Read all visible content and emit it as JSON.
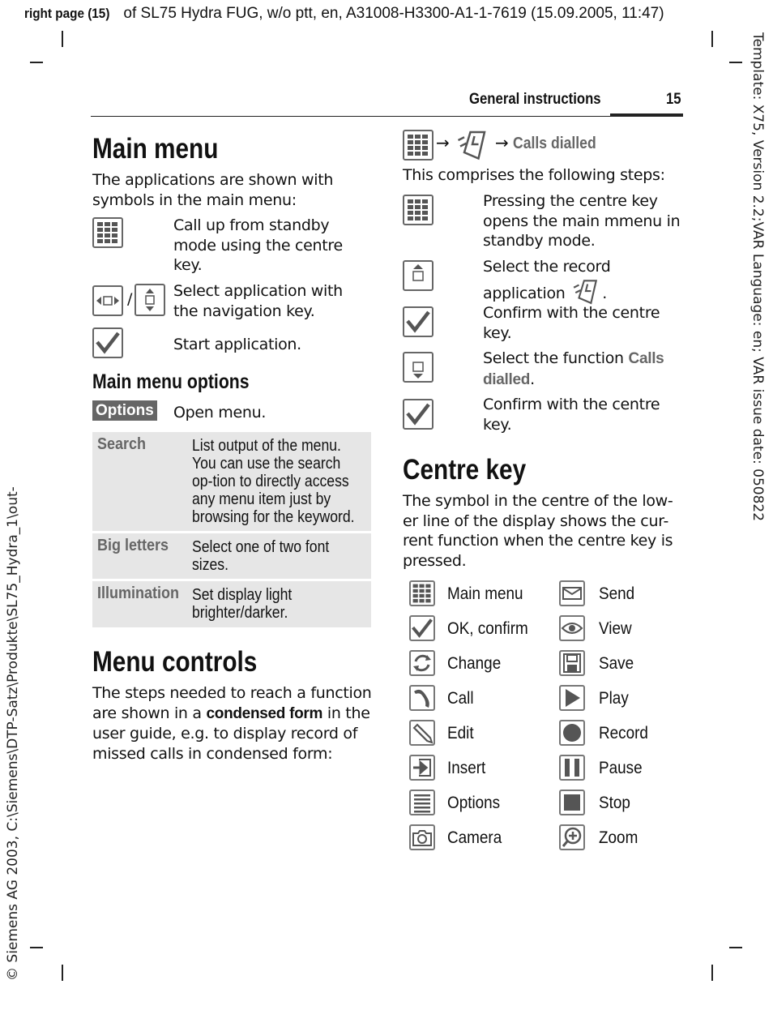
{
  "print_header": {
    "bold": "right page (15)",
    "rest": " of SL75 Hydra FUG, w/o ptt, en, A31008-H3300-A1-1-7619 (15.09.2005, 11:47)"
  },
  "side_right": "Template: X75, Version 2.2;VAR Language: en; VAR issue date: 050822",
  "side_left": "© Siemens AG 2003, C:\\Siemens\\DTP-Satz\\Produkte\\SL75_Hydra_1\\out-",
  "running_header": {
    "section": "General instructions",
    "page": "15"
  },
  "main_menu": {
    "title": "Main menu",
    "intro": "The applications are shown with symbols in the main menu:",
    "steps": [
      {
        "icon": "main-menu-icon",
        "text": "Call up from standby mode using the centre key."
      },
      {
        "icon": "navigation-key-icon",
        "separator": "/",
        "text": "Select application with the navigation key."
      },
      {
        "icon": "check-icon",
        "text": "Start application."
      }
    ]
  },
  "main_menu_options": {
    "title": "Main menu options",
    "softkey": "Options",
    "softkey_text": "Open menu.",
    "rows": [
      {
        "key": "Search",
        "value": "List output of the menu. You can use the search op-tion to directly access any menu item just by browsing for the keyword."
      },
      {
        "key": "Big letters",
        "value": "Select one of two font sizes."
      },
      {
        "key": "Illumination",
        "value": "Set display light brighter/darker."
      }
    ]
  },
  "menu_controls": {
    "title": "Menu controls",
    "text_a": "The steps needed to reach a function are shown in a ",
    "text_bold": "condensed form",
    "text_b": " in the user guide, e.g. to display record of missed calls in condensed form:"
  },
  "condensed": {
    "arrow": "→",
    "target": "Calls dialled",
    "intro": "This comprises the following steps:",
    "steps": [
      {
        "icon": "main-menu-icon",
        "text": "Pressing the centre key opens the main mmenu in standby mode."
      },
      {
        "icon": "nav-up-icon",
        "text": "Select the record application",
        "tail": "."
      },
      {
        "icon": "check-icon",
        "text": "Confirm with the centre key."
      },
      {
        "icon": "nav-down-icon",
        "text": "Select the function ",
        "bold": "Calls dialled",
        "tail": "."
      },
      {
        "icon": "check-icon",
        "text": "Confirm with the centre key."
      }
    ]
  },
  "centre_key": {
    "title": "Centre key",
    "intro": "The symbol in the centre of the low-er line of the display shows the cur-rent function when the centre key is pressed.",
    "symbols_left": [
      {
        "icon": "main-menu-icon",
        "label": "Main menu"
      },
      {
        "icon": "check-icon",
        "label": "OK, confirm"
      },
      {
        "icon": "change-icon",
        "label": "Change"
      },
      {
        "icon": "call-icon",
        "label": "Call"
      },
      {
        "icon": "edit-icon",
        "label": "Edit"
      },
      {
        "icon": "insert-icon",
        "label": "Insert"
      },
      {
        "icon": "options-icon",
        "label": "Options"
      },
      {
        "icon": "camera-icon",
        "label": "Camera"
      }
    ],
    "symbols_right": [
      {
        "icon": "send-icon",
        "label": "Send"
      },
      {
        "icon": "view-icon",
        "label": "View"
      },
      {
        "icon": "save-icon",
        "label": "Save"
      },
      {
        "icon": "play-icon",
        "label": "Play"
      },
      {
        "icon": "record-icon",
        "label": "Record"
      },
      {
        "icon": "pause-icon",
        "label": "Pause"
      },
      {
        "icon": "stop-icon",
        "label": "Stop"
      },
      {
        "icon": "zoom-icon",
        "label": "Zoom"
      }
    ]
  },
  "colors": {
    "icon": "#666666",
    "table_bg": "#e6e6e6",
    "grey_text": "#666666"
  }
}
